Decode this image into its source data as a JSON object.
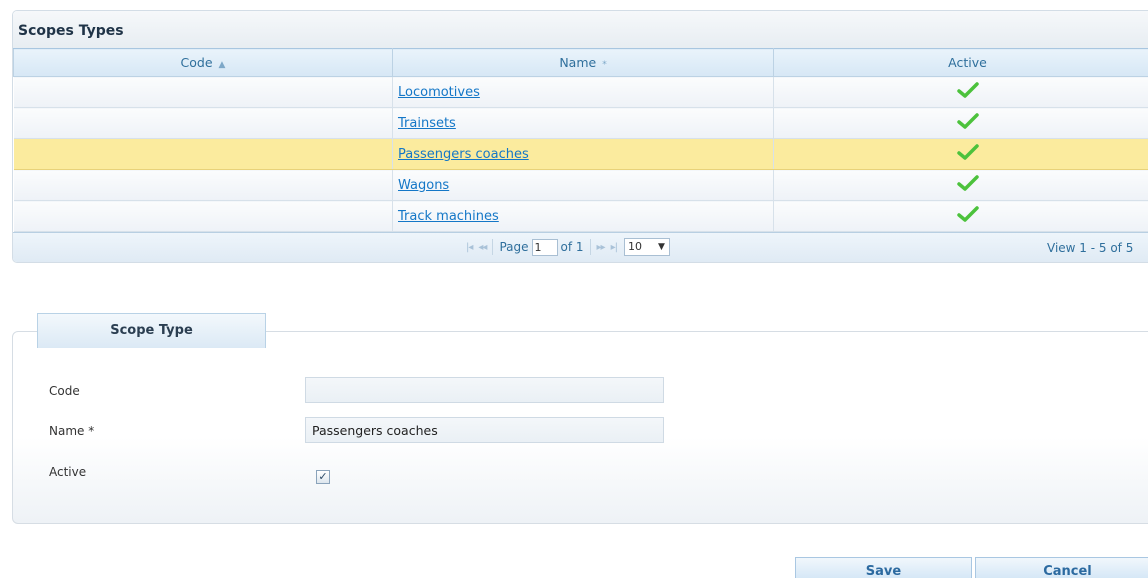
{
  "grid": {
    "title": "Scopes Types",
    "columns": {
      "code": "Code",
      "name": "Name",
      "active": "Active"
    },
    "rows": [
      {
        "code": "",
        "name": "Locomotives",
        "active": true
      },
      {
        "code": "",
        "name": "Trainsets",
        "active": true
      },
      {
        "code": "",
        "name": "Passengers coaches",
        "active": true,
        "selected": true
      },
      {
        "code": "",
        "name": "Wagons",
        "active": true
      },
      {
        "code": "",
        "name": "Track machines",
        "active": true
      }
    ],
    "pager": {
      "page_label": "Page",
      "page_value": "1",
      "of_label": "of 1",
      "rows_per_page": "10",
      "view_text": "View 1 - 5 of 5"
    }
  },
  "form": {
    "tab_label": "Scope Type",
    "code_label": "Code",
    "code_value": "",
    "name_label": "Name *",
    "name_value": "Passengers coaches",
    "active_label": "Active",
    "active_checked": true
  },
  "buttons": {
    "save": "Save",
    "cancel": "Cancel"
  },
  "colors": {
    "selected_row": "#fbeb9e",
    "link": "#1477c7",
    "check": "#4cc23c"
  },
  "icons": {
    "sort": "sort-icon",
    "check": "check-icon",
    "first_page": "first-page-icon",
    "prev_page": "prev-page-icon",
    "next_page": "next-page-icon",
    "last_page": "last-page-icon"
  }
}
